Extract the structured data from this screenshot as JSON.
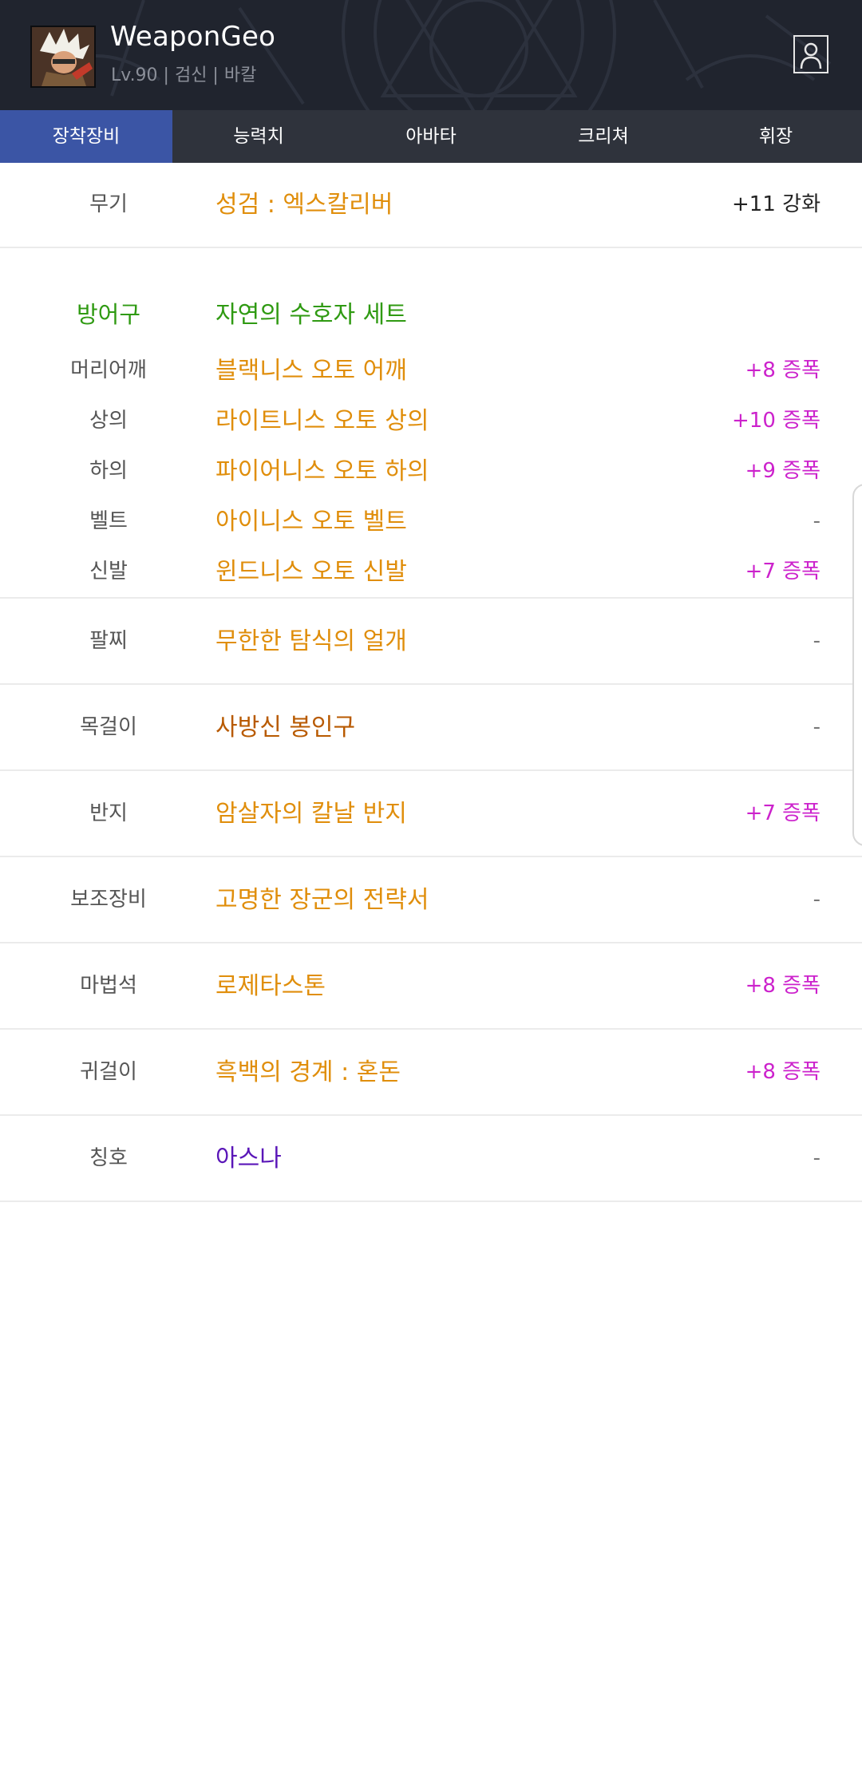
{
  "header": {
    "name": "WeaponGeo",
    "subtitle": "Lv.90 | 검신 | 바칼"
  },
  "tabs": [
    {
      "label": "장착장비",
      "active": true
    },
    {
      "label": "능력치"
    },
    {
      "label": "아바타"
    },
    {
      "label": "크리쳐"
    },
    {
      "label": "휘장"
    }
  ],
  "weapon": {
    "slot": "무기",
    "item": "성검 : 엑스칼리버",
    "upgrade": "+11 강화"
  },
  "armor": {
    "slot": "방어구",
    "set_name": "자연의 수호자 세트",
    "items": [
      {
        "slot": "머리어깨",
        "item": "블랙니스 오토 어깨",
        "upgrade": "+8 증폭"
      },
      {
        "slot": "상의",
        "item": "라이트니스 오토 상의",
        "upgrade": "+10 증폭"
      },
      {
        "slot": "하의",
        "item": "파이어니스 오토 하의",
        "upgrade": "+9 증폭"
      },
      {
        "slot": "벨트",
        "item": "아이니스 오토 벨트",
        "upgrade": "-"
      },
      {
        "slot": "신발",
        "item": "윈드니스 오토 신발",
        "upgrade": "+7 증폭"
      }
    ]
  },
  "accessories": [
    {
      "slot": "팔찌",
      "item": "무한한 탐식의 얼개",
      "upgrade": "-"
    },
    {
      "slot": "목걸이",
      "item": "사방신 봉인구",
      "upgrade": "-"
    },
    {
      "slot": "반지",
      "item": "암살자의 칼날 반지",
      "upgrade": "+7 증폭"
    },
    {
      "slot": "보조장비",
      "item": "고명한 장군의 전략서",
      "upgrade": "-"
    },
    {
      "slot": "마법석",
      "item": "로제타스톤",
      "upgrade": "+8 증폭"
    },
    {
      "slot": "귀걸이",
      "item": "흑백의 경계 : 혼돈",
      "upgrade": "+8 증폭"
    },
    {
      "slot": "칭호",
      "item": "아스나",
      "upgrade": "-"
    }
  ],
  "colors": {
    "header_bg": "#20242e",
    "tab_bar": "#2f333c",
    "tab_active": "#3b55a5",
    "item_orange": "#e08e0b",
    "set_green": "#2f9a12",
    "upgrade_magenta": "#cc22cc",
    "item_brown": "#b85a00",
    "title_purple": "#5a16b8"
  },
  "icons": {
    "avatar": "character-portrait",
    "profile": "user-profile-icon"
  }
}
